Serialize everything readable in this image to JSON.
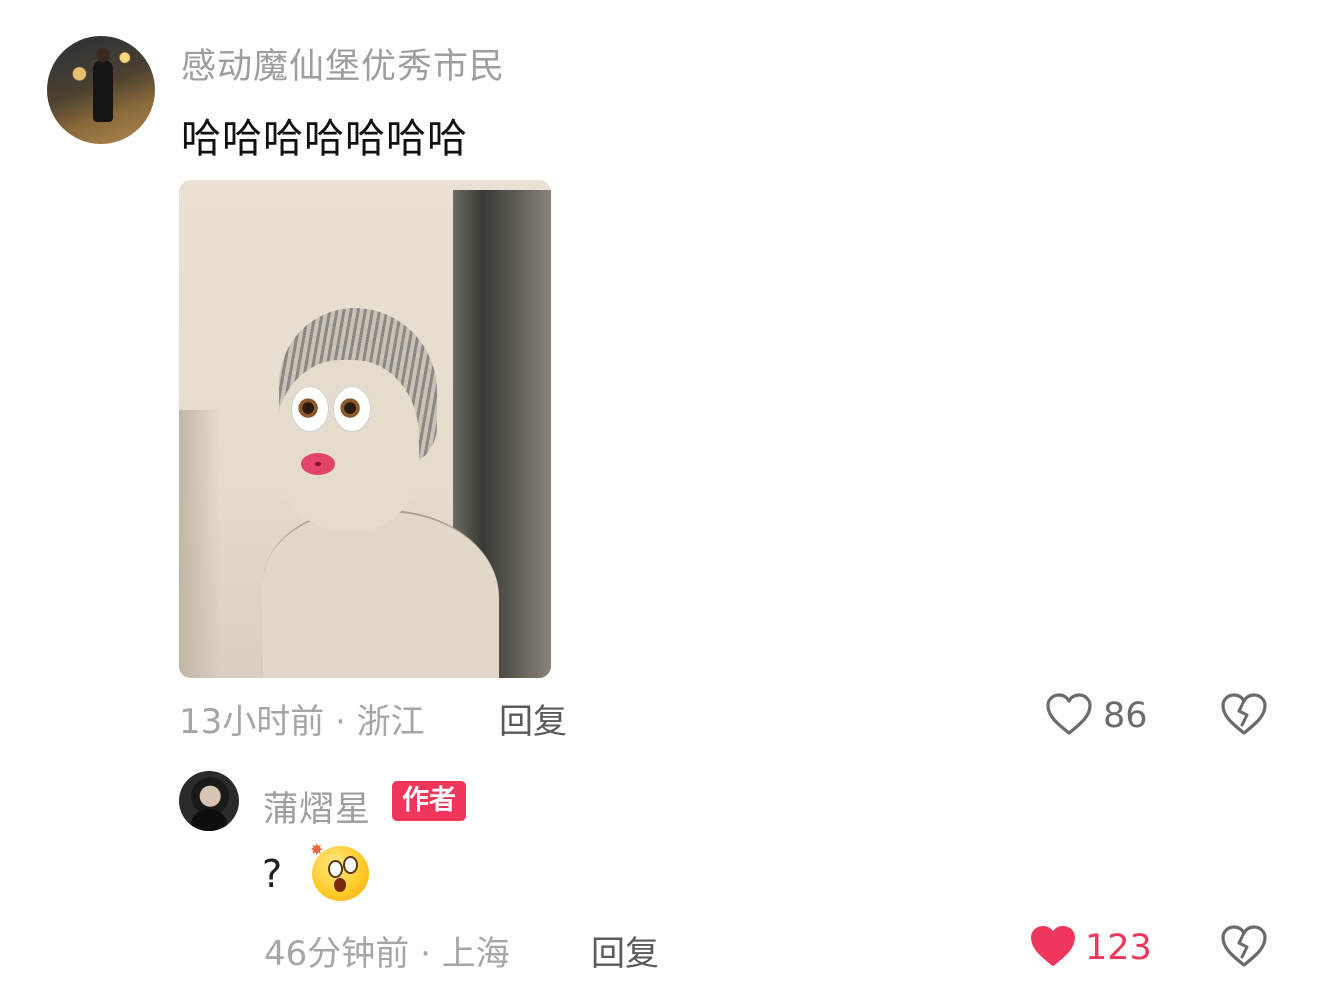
{
  "comment": {
    "username": "感动魔仙堡优秀市民",
    "text": "哈哈哈哈哈哈哈",
    "time_location": "13小时前 · 浙江",
    "reply_label": "回复",
    "like_count": "86",
    "liked": false
  },
  "reply": {
    "username": "蒲熠星",
    "badge": "作者",
    "text": "?",
    "emoji": "shocked-face-emoji",
    "time_location": "46分钟前 · 上海",
    "reply_label": "回复",
    "like_count": "123",
    "liked": true
  },
  "colors": {
    "like_active": "#f0365a",
    "badge_bg": "#f0365a",
    "meta_text": "#a6a6a6",
    "username_text": "#9e9e9e"
  },
  "icons": {
    "like": "heart-icon",
    "dislike": "broken-heart-icon"
  }
}
